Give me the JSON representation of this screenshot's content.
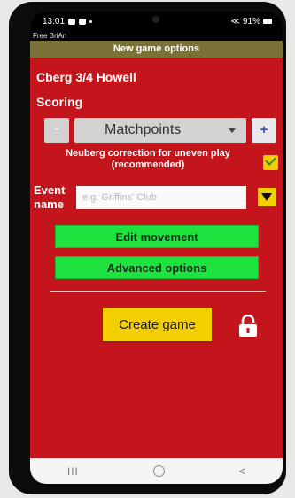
{
  "status_bar": {
    "time": "13:01",
    "signal_text": "91%"
  },
  "app": {
    "name": "Free BriAn"
  },
  "screen": {
    "title": "New game options",
    "movement_name": "Cberg 3/4 Howell",
    "scoring_label": "Scoring"
  },
  "scoring": {
    "minus_label": "-",
    "selected": "Matchpoints",
    "plus_label": "+"
  },
  "neuberg": {
    "label": "Neuberg correction for uneven play (recommended)",
    "checked": true
  },
  "event": {
    "label_line1": "Event",
    "label_line2": "name",
    "value": "",
    "placeholder": "e.g. Griffins' Club"
  },
  "buttons": {
    "edit_movement": "Edit movement",
    "advanced_options": "Advanced options",
    "create_game": "Create game"
  },
  "nav": {
    "recent": "III",
    "back": "<"
  },
  "colors": {
    "background": "#c4151c",
    "title_bar": "#7a7236",
    "green_button": "#1ee23d",
    "yellow_accent": "#f3cf00"
  }
}
